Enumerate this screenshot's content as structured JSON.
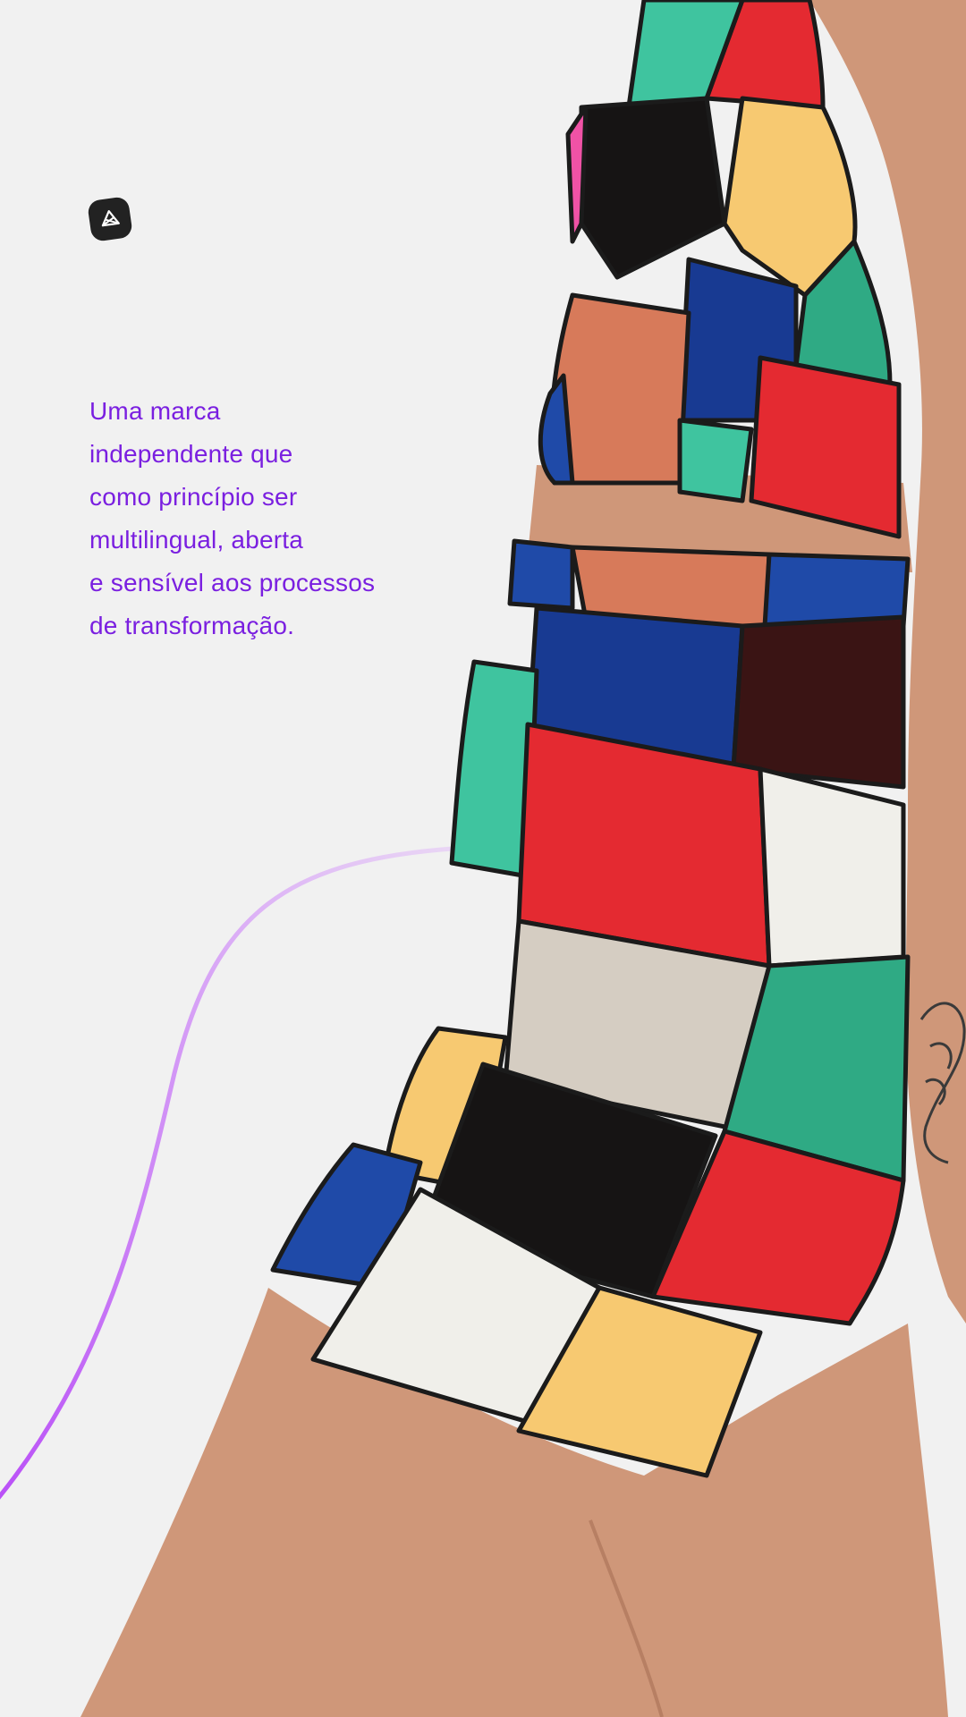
{
  "brand": {
    "logo_icon": "abstract-geometric-logo-icon"
  },
  "tagline": {
    "lines": [
      "Uma marca",
      "independente que",
      "como princípio ser",
      "multilingual, aberta",
      "e sensível aos processos",
      "de transformação."
    ]
  },
  "colors": {
    "background": "#f1f1f1",
    "accent_text": "#7a1fe0",
    "curve_start": "#b94ef7",
    "curve_end": "#e6d3f4",
    "patch_red": "#e42a31",
    "patch_green": "#2faa84",
    "patch_mint": "#3fc49f",
    "patch_yellow": "#f7c971",
    "patch_blue": "#1f4aa8",
    "patch_navy": "#183a92",
    "patch_black": "#161414",
    "patch_white": "#f0efea",
    "patch_beige": "#d5cdc2",
    "patch_salmon": "#d77a5a",
    "patch_pink": "#f052a6",
    "skin": "#cf9779"
  }
}
